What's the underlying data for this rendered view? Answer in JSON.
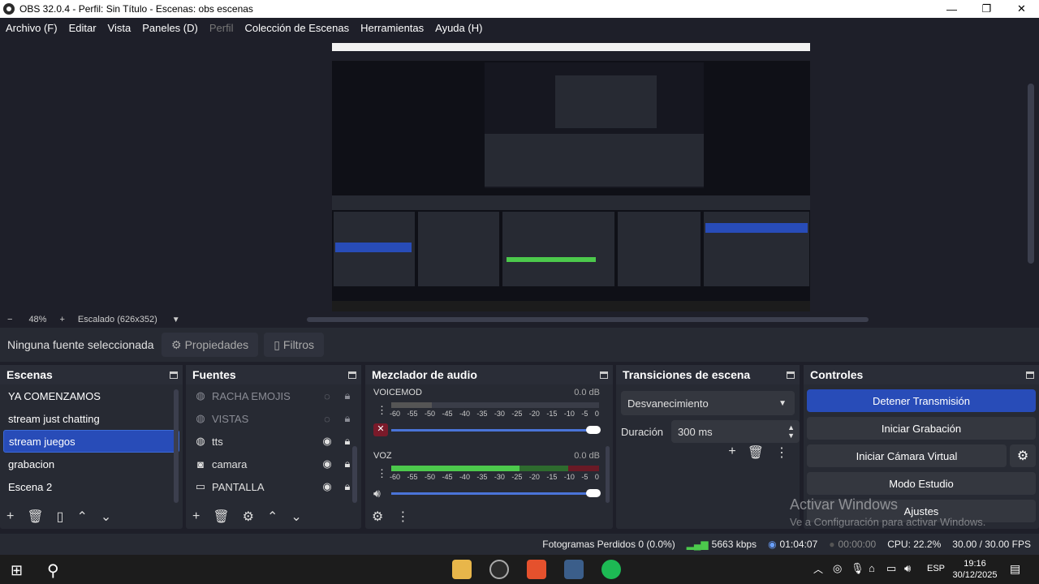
{
  "window": {
    "title": "OBS 32.0.4 - Perfil: Sin Título - Escenas: obs escenas",
    "minimize": "—",
    "maximize": "❐",
    "close": "✕"
  },
  "menu": [
    {
      "label": "Archivo (F)",
      "disabled": false
    },
    {
      "label": "Editar",
      "disabled": false
    },
    {
      "label": "Vista",
      "disabled": false
    },
    {
      "label": "Paneles (D)",
      "disabled": false
    },
    {
      "label": "Perfil",
      "disabled": true
    },
    {
      "label": "Colección de Escenas",
      "disabled": false
    },
    {
      "label": "Herramientas",
      "disabled": false
    },
    {
      "label": "Ayuda (H)",
      "disabled": false
    }
  ],
  "preview_bar": {
    "minus": "−",
    "zoom": "48%",
    "plus": "+",
    "scale": "Escalado (626x352)"
  },
  "source_toolbar": {
    "no_source": "Ninguna fuente seleccionada",
    "properties": "Propiedades",
    "filters": "Filtros"
  },
  "scenes": {
    "title": "Escenas",
    "items": [
      "YA COMENZAMOS",
      "stream just chatting",
      "stream juegos",
      "grabacion",
      "Escena 2"
    ],
    "selected_index": 2
  },
  "sources": {
    "title": "Fuentes",
    "items": [
      {
        "label": "RACHA EMOJIS",
        "icon": "browser-icon",
        "visible": false
      },
      {
        "label": "VISTAS",
        "icon": "browser-icon",
        "visible": false
      },
      {
        "label": "tts",
        "icon": "browser-icon",
        "visible": true
      },
      {
        "label": "camara",
        "icon": "camera-icon",
        "visible": true
      },
      {
        "label": "PANTALLA",
        "icon": "monitor-icon",
        "visible": true
      }
    ]
  },
  "mixer": {
    "title": "Mezclador de audio",
    "channels": [
      {
        "name": "VOICEMOD",
        "db": "0.0 dB",
        "muted": true,
        "level": 0.2
      },
      {
        "name": "VOZ",
        "db": "0.0 dB",
        "muted": false,
        "level": 0.6
      }
    ],
    "ticks": [
      "-60",
      "-55",
      "-50",
      "-45",
      "-40",
      "-35",
      "-30",
      "-25",
      "-20",
      "-15",
      "-10",
      "-5",
      "0"
    ]
  },
  "transitions": {
    "title": "Transiciones de escena",
    "selected": "Desvanecimiento",
    "duration_label": "Duración",
    "duration_value": "300 ms"
  },
  "controls": {
    "title": "Controles",
    "stop_stream": "Detener Transmisión",
    "start_recording": "Iniciar Grabación",
    "virtual_cam": "Iniciar Cámara Virtual",
    "studio_mode": "Modo Estudio",
    "settings": "Ajustes"
  },
  "watermark": {
    "line1": "Activar Windows",
    "line2": "Ve a Configuración para activar Windows."
  },
  "status": {
    "dropped": "Fotogramas Perdidos 0 (0.0%)",
    "bitrate": "5663 kbps",
    "stream_time": "01:04:07",
    "rec_time": "00:00:00",
    "cpu": "CPU: 22.2%",
    "fps": "30.00 / 30.00 FPS"
  },
  "taskbar": {
    "lang": "ESP",
    "time": "19:16",
    "date": "30/12/2025"
  },
  "colors": {
    "accent": "#284cb8",
    "panel": "#272a33",
    "bg": "#1e1f29",
    "meter_green": "#4cc94c",
    "meter_yellow": "#8a7a20",
    "meter_red": "#8a1a2a"
  }
}
